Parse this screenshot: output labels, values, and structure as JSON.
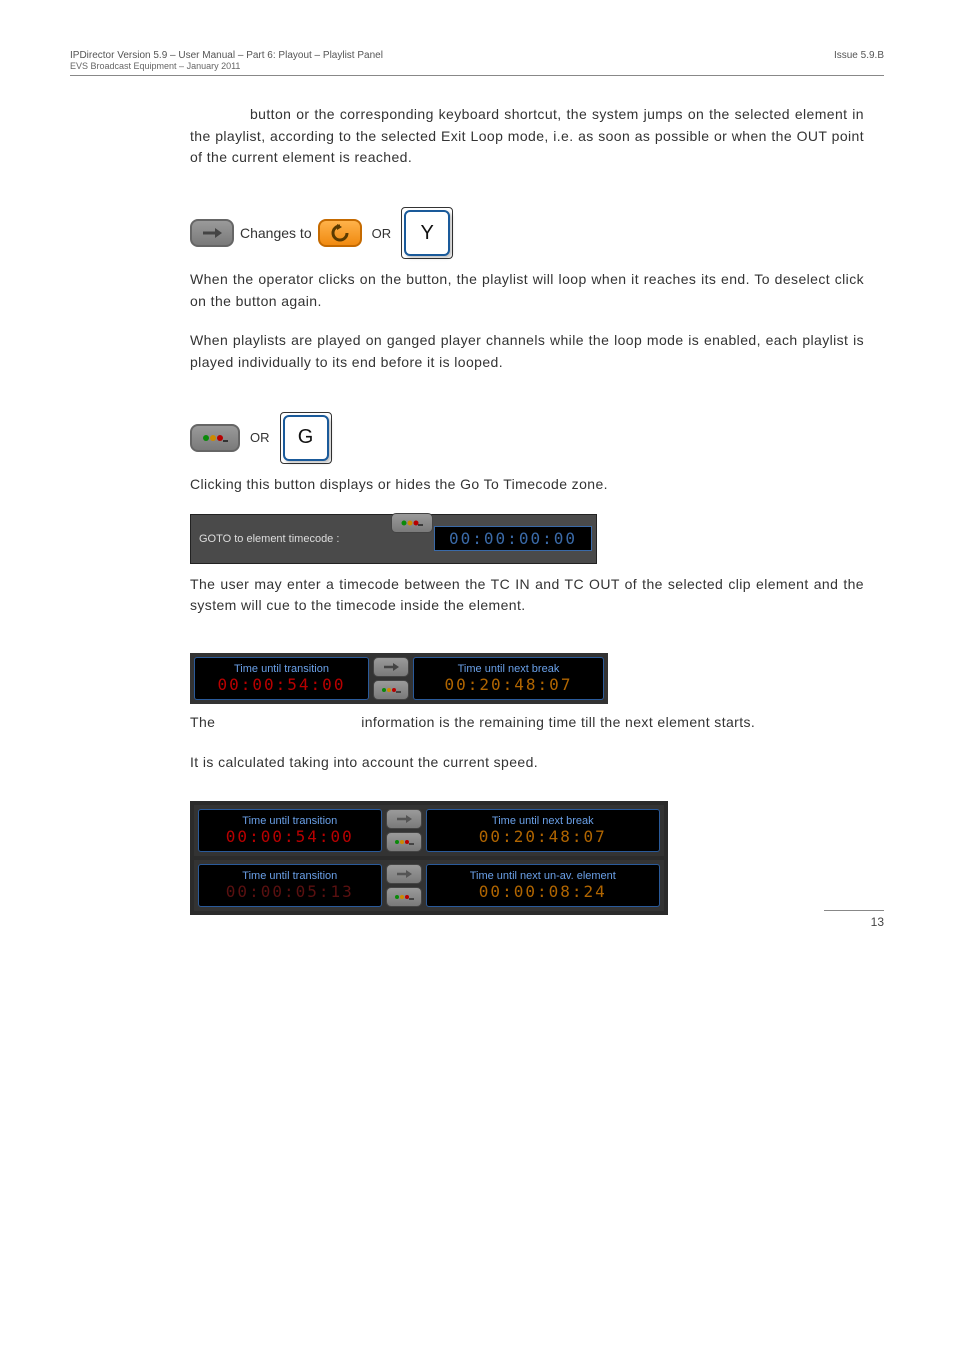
{
  "header": {
    "left_line1": "IPDirector Version 5.9 – User Manual – Part 6: Playout – Playlist Panel",
    "left_line2": "EVS Broadcast Equipment – January 2011",
    "right": "Issue 5.9.B"
  },
  "intro_paragraph": "button or the corresponding keyboard shortcut, the system jumps on the selected element in the playlist, according to the selected Exit Loop mode, i.e. as soon as possible or when the OUT point of the current element is reached.",
  "loop_row": {
    "changes_to": "Changes to",
    "or": "OR",
    "key": "Y"
  },
  "loop_para1": "When the operator clicks on the           button, the playlist will loop when it reaches its end. To deselect            click on the           button again.",
  "loop_para2": "When playlists are played on ganged player channels while the loop mode is enabled, each playlist is played individually to its end before it is looped.",
  "goto_row": {
    "or": "OR",
    "key": "G"
  },
  "goto_para1": "Clicking this button displays or hides the Go To Timecode zone.",
  "goto_figure": {
    "label": "GOTO to element timecode :",
    "tc": "00:00:00:00"
  },
  "goto_para2": "The user may enter a timecode between the TC IN and TC OUT of the selected clip element and the system will cue to the timecode inside the element.",
  "info1": {
    "left_title": "Time until transition",
    "left_tc": "00:00:54:00",
    "right_title": "Time until next break",
    "right_tc": "00:20:48:07"
  },
  "info_para_prefix": "The",
  "info_para_rest": "information is the remaining time till the next element starts.",
  "info_para2": "It is calculated taking into account the current speed.",
  "info2a": {
    "left_title": "Time until transition",
    "left_tc": "00:00:54:00",
    "right_title": "Time until next break",
    "right_tc": "00:20:48:07"
  },
  "info2b": {
    "left_title": "Time until transition",
    "left_tc": "00:00:05:13",
    "right_title": "Time until next un-av. element",
    "right_tc": "00:00:08:24"
  },
  "footer": {
    "page": "13"
  }
}
